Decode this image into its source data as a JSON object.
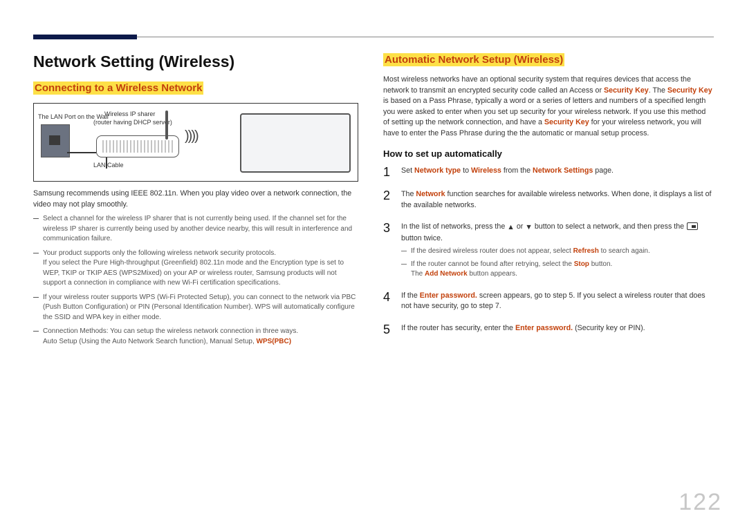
{
  "page_number": "122",
  "title": "Network Setting (Wireless)",
  "left": {
    "heading": "Connecting to a Wireless Network",
    "diagram": {
      "lan_port_label": "The LAN Port on the Wall",
      "lan_cable_label": "LAN Cable",
      "router_label1": "Wireless IP sharer",
      "router_label2": "(router having DHCP server)"
    },
    "intro": "Samsung recommends using IEEE 802.11n. When you play video over a network connection, the video may not play smoothly.",
    "notes": {
      "n1": "Select a channel for the wireless IP sharer that is not currently being used. If the channel set for the wireless IP sharer is currently being used by another device nearby, this will result in interference and communication failure.",
      "n2a": "Your product supports only the following wireless network security protocols.",
      "n2b": "If you select the Pure High-throughput (Greenfield) 802.11n mode and the Encryption type is set to WEP, TKIP or TKIP AES (WPS2Mixed) on your AP or wireless router, Samsung products will not support a connection in compliance with new Wi-Fi certification specifications.",
      "n3": "If your wireless router supports WPS (Wi-Fi Protected Setup), you can connect to the network via PBC (Push Button Configuration) or PIN (Personal Identification Number). WPS will automatically configure the SSID and WPA key in either mode.",
      "n4a": "Connection Methods: You can setup the wireless network connection in three ways.",
      "n4b_pre": "Auto Setup (Using the Auto Network Search function), Manual Setup, ",
      "n4b_bold": "WPS(PBC)"
    }
  },
  "right": {
    "heading": "Automatic Network Setup (Wireless)",
    "para": {
      "t1": "Most wireless networks have an optional security system that requires devices that access the network to transmit an encrypted security code called an Access or ",
      "sk1": "Security Key",
      "t2": ". The ",
      "sk2": "Security Key",
      "t3": " is based on a Pass Phrase, typically a word or a series of letters and numbers of a specified length you were asked to enter when you set up security for your wireless network. If you use this method of setting up the network connection, and have a ",
      "sk3": "Security Key",
      "t4": " for your wireless network, you will have to enter the Pass Phrase during the the automatic or manual setup process."
    },
    "howto_heading": "How to set up automatically",
    "steps": {
      "s1": {
        "pre": "Set ",
        "b1": "Network type",
        "mid1": " to ",
        "b2": "Wireless",
        "mid2": " from the ",
        "b3": "Network Settings",
        "post": " page."
      },
      "s2": {
        "pre": "The ",
        "b1": "Network",
        "post": " function searches for available wireless networks. When done, it displays a list of the available networks."
      },
      "s3": {
        "line_pre": "In the list of networks, press the ",
        "or": " or ",
        "line_mid": " button to select a network, and then press the ",
        "line_post": " button twice.",
        "sub1_pre": "If the desired wireless router does not appear, select ",
        "sub1_b": "Refresh",
        "sub1_post": " to search again.",
        "sub2_pre": "If the router cannot be found after retrying, select the ",
        "sub2_b": "Stop",
        "sub2_post": " button.",
        "sub3_pre": "The ",
        "sub3_b": "Add Network",
        "sub3_post": " button appears."
      },
      "s4": {
        "pre": "If the ",
        "b1": "Enter password.",
        "post": " screen appears, go to step 5. If you select a wireless router that does not have security, go to step 7."
      },
      "s5": {
        "pre": "If the router has security, enter the ",
        "b1": "Enter password.",
        "post": " (Security key or PIN)."
      }
    }
  }
}
